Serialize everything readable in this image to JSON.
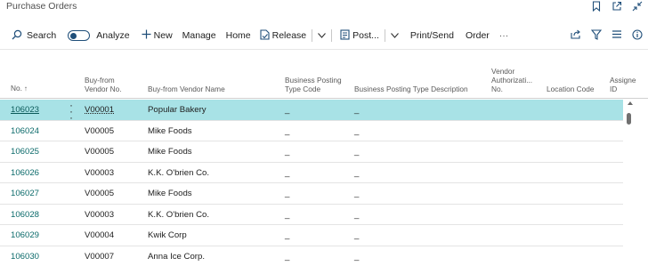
{
  "page": {
    "title": "Purchase Orders"
  },
  "actions": {
    "search": "Search",
    "analyze": "Analyze",
    "new": "New",
    "manage": "Manage",
    "home": "Home",
    "release": "Release",
    "post": "Post...",
    "print_send": "Print/Send",
    "order": "Order",
    "more": "···"
  },
  "columns": {
    "no": "No.",
    "no_sort": "↑",
    "vendor_no_1": "Buy-from",
    "vendor_no_2": "Vendor No.",
    "vendor_name": "Buy-from Vendor Name",
    "bpt_code_1": "Business Posting",
    "bpt_code_2": "Type Code",
    "bpt_desc": "Business Posting Type Description",
    "vendor_auth_1": "Vendor",
    "vendor_auth_2": "Authorizati...",
    "vendor_auth_3": "No.",
    "location": "Location Code",
    "assigned_1": "Assigne",
    "assigned_2": "ID"
  },
  "rows": [
    {
      "no": "106023",
      "vendor_no": "V00001",
      "vendor_name": "Popular Bakery",
      "bpt_code": "_",
      "bpt_desc": "_",
      "selected": true
    },
    {
      "no": "106024",
      "vendor_no": "V00005",
      "vendor_name": "Mike Foods",
      "bpt_code": "_",
      "bpt_desc": "_"
    },
    {
      "no": "106025",
      "vendor_no": "V00005",
      "vendor_name": "Mike Foods",
      "bpt_code": "_",
      "bpt_desc": "_"
    },
    {
      "no": "106026",
      "vendor_no": "V00003",
      "vendor_name": "K.K. O'brien Co.",
      "bpt_code": "_",
      "bpt_desc": "_"
    },
    {
      "no": "106027",
      "vendor_no": "V00005",
      "vendor_name": "Mike Foods",
      "bpt_code": "_",
      "bpt_desc": "_"
    },
    {
      "no": "106028",
      "vendor_no": "V00003",
      "vendor_name": "K.K. O'brien Co.",
      "bpt_code": "_",
      "bpt_desc": "_"
    },
    {
      "no": "106029",
      "vendor_no": "V00004",
      "vendor_name": "Kwik Corp",
      "bpt_code": "_",
      "bpt_desc": "_"
    },
    {
      "no": "106030",
      "vendor_no": "V00007",
      "vendor_name": "Anna Ice Corp.",
      "bpt_code": "_",
      "bpt_desc": "_"
    }
  ],
  "colors": {
    "accent": "#0b6a6a",
    "selected_row": "#a8e2e6",
    "toggle": "#1f4e79"
  },
  "icons": [
    "bookmark-icon",
    "open-new-window-icon",
    "collapse-icon",
    "search-icon",
    "plus-icon",
    "release-icon",
    "post-icon",
    "chevron-down-icon",
    "share-icon",
    "filter-icon",
    "list-view-icon",
    "info-icon"
  ]
}
